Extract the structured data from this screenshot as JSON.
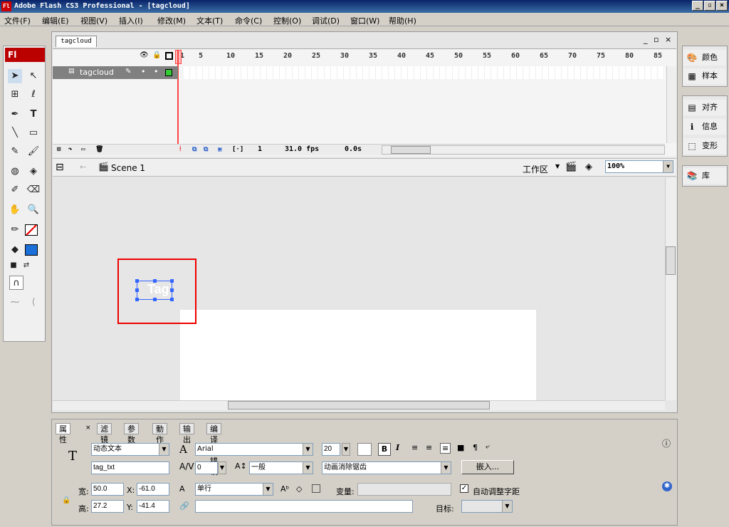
{
  "window": {
    "title": "Adobe Flash CS3 Professional - [tagcloud]",
    "app_icon": "Fl"
  },
  "menu": [
    "文件(F)",
    "编辑(E)",
    "视图(V)",
    "插入(I)",
    "修改(M)",
    "文本(T)",
    "命令(C)",
    "控制(O)",
    "调试(D)",
    "窗口(W)",
    "帮助(H)"
  ],
  "document": {
    "tab": "tagcloud"
  },
  "timeline": {
    "ticks": [
      "1",
      "5",
      "10",
      "15",
      "20",
      "25",
      "30",
      "35",
      "40",
      "45",
      "50",
      "55",
      "60",
      "65",
      "70",
      "75",
      "80",
      "85"
    ],
    "layer_name": "tagcloud",
    "frame": "1",
    "fps": "31.0 fps",
    "time": "0.0s"
  },
  "editbar": {
    "scene": "Scene 1",
    "workspace": "工作区",
    "zoom": "100%"
  },
  "stage": {
    "selected_text": "Tag"
  },
  "toolbox": {
    "label": "Fl"
  },
  "props": {
    "tabs": [
      "属性",
      "滤镜",
      "参数",
      "動作",
      "输出",
      "编译器错误"
    ],
    "text_type": "动态文本",
    "instance_name": "tag_txt",
    "font": "Arial",
    "size": "20",
    "letter_spacing": "0",
    "baseline": "一般",
    "antialias": "动画消除锯齿",
    "embed_button": "嵌入...",
    "width_label": "宽:",
    "width": "50.0",
    "x_label": "X:",
    "x": "-61.0",
    "height_label": "高:",
    "height": "27.2",
    "y_label": "Y:",
    "y": "-41.4",
    "line_type": "单行",
    "var_label": "变量:",
    "auto_kern": "自动调整字距",
    "target_label": "目标:"
  },
  "right_panel": {
    "items": [
      "颜色",
      "样本",
      "对齐",
      "信息",
      "变形",
      "库"
    ]
  }
}
